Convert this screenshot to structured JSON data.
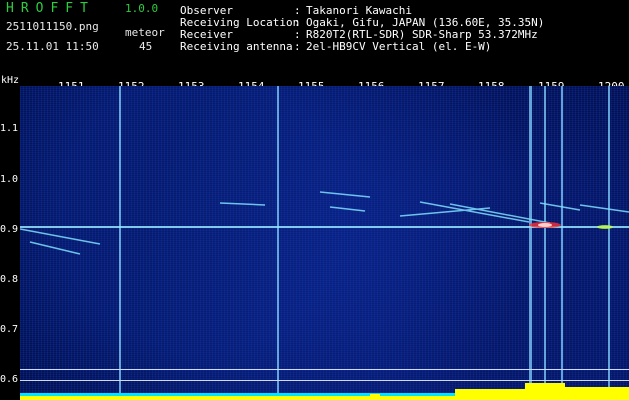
{
  "header": {
    "app_title": "HROFFT",
    "version": "1.0.0",
    "filename": "2511011150.png",
    "mode_label": "meteor",
    "timestamp": "25.11.01 11:50",
    "count": "45"
  },
  "info": [
    {
      "label": "Observer",
      "value": "Takanori Kawachi"
    },
    {
      "label": "Receiving Location",
      "value": "Ogaki, Gifu, JAPAN (136.60E, 35.35N)"
    },
    {
      "label": "Receiver",
      "value": "R820T2(RTL-SDR) SDR-Sharp 53.372MHz"
    },
    {
      "label": "Receiving antenna",
      "value": "2el-HB9CV Vertical (el. E-W)"
    }
  ],
  "axis": {
    "y_unit": "kHz",
    "y_ticks": [
      "1.1",
      "1.0",
      "0.9",
      "0.8",
      "0.7",
      "0.6"
    ],
    "x_ticks": [
      "1151",
      "1152",
      "1153",
      "1154",
      "1155",
      "1156",
      "1157",
      "1158",
      "1159",
      "1200"
    ]
  },
  "colors": {
    "title_green": "#2ecc40",
    "background": "#00104a",
    "spectrum_yellow": "#ffff00",
    "spectrum_cyan": "#00e5ff"
  }
}
